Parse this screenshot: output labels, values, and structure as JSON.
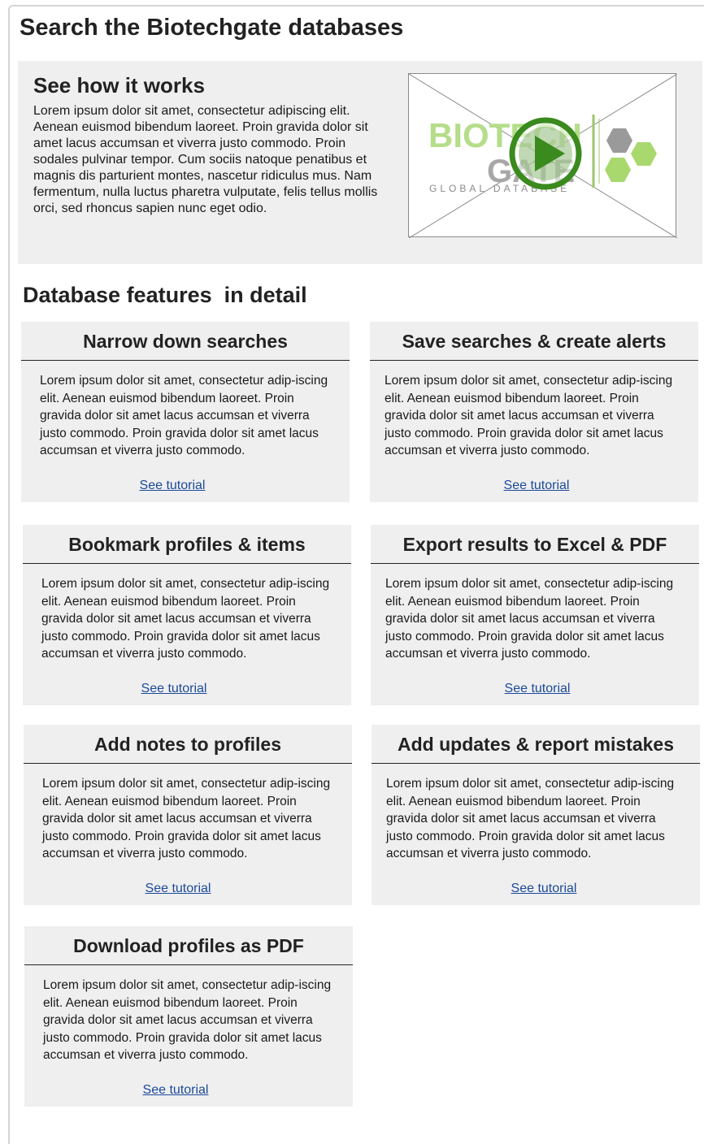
{
  "page": {
    "title": "Search the Biotechgate databases"
  },
  "hero": {
    "title": "See how it works",
    "text": "Lorem ipsum dolor sit amet, consectetur adipiscing elit. Aenean euismod bibendum laoreet. Proin gravida dolor sit amet lacus accumsan et viverra justo commodo. Proin sodales pulvinar tempor. Cum sociis natoque penatibus et magnis dis parturient montes, nascetur ridiculus mus. Nam fermentum, nulla luctus pharetra vulputate, felis tellus mollis orci, sed rhoncus sapien nunc eget odio.",
    "video": {
      "logo_line1": "BIOTECH",
      "logo_line2": "GATE",
      "logo_tagline": "GLOBAL DATABASE",
      "icon": "play-icon"
    }
  },
  "features": {
    "title": "Database features  in detail",
    "cards": [
      {
        "title": "Narrow down searches",
        "text": "Lorem ipsum dolor sit amet, consectetur adip-iscing elit. Aenean euismod bibendum laoreet. Proin gravida dolor sit amet lacus accumsan et viverra justo commodo. Proin gravida dolor sit amet lacus accumsan et viverra justo commodo.",
        "link": "See tutorial"
      },
      {
        "title": "Save searches & create alerts",
        "text": "Lorem ipsum dolor sit amet, consectetur adip-iscing elit. Aenean euismod bibendum laoreet. Proin gravida dolor sit amet lacus accumsan et viverra justo commodo. Proin gravida dolor sit amet lacus accumsan et viverra justo commodo.",
        "link": "See tutorial"
      },
      {
        "title": "Bookmark profiles & items",
        "text": "Lorem ipsum dolor sit amet, consectetur adip-iscing elit. Aenean euismod bibendum laoreet. Proin gravida dolor sit amet lacus accumsan et viverra justo commodo. Proin gravida dolor sit amet lacus accumsan et viverra justo commodo.",
        "link": "See tutorial"
      },
      {
        "title": "Export results to Excel & PDF",
        "text": "Lorem ipsum dolor sit amet, consectetur adip-iscing elit. Aenean euismod bibendum laoreet. Proin gravida dolor sit amet lacus accumsan et viverra justo commodo. Proin gravida dolor sit amet lacus accumsan et viverra justo commodo.",
        "link": "See tutorial"
      },
      {
        "title": "Add notes to profiles",
        "text": "Lorem ipsum dolor sit amet, consectetur adip-iscing elit. Aenean euismod bibendum laoreet. Proin gravida dolor sit amet lacus accumsan et viverra justo commodo. Proin gravida dolor sit amet lacus accumsan et viverra justo commodo.",
        "link": "See tutorial"
      },
      {
        "title": "Add updates & report mistakes",
        "text": "Lorem ipsum dolor sit amet, consectetur adip-iscing elit. Aenean euismod bibendum laoreet. Proin gravida dolor sit amet lacus accumsan et viverra justo commodo. Proin gravida dolor sit amet lacus accumsan et viverra justo commodo.",
        "link": "See tutorial"
      },
      {
        "title": "Download profiles as PDF",
        "text": "Lorem ipsum dolor sit amet, consectetur adip-iscing elit. Aenean euismod bibendum laoreet. Proin gravida dolor sit amet lacus accumsan et viverra justo commodo. Proin gravida dolor sit amet lacus accumsan et viverra justo commodo.",
        "link": "See tutorial"
      }
    ]
  },
  "colors": {
    "panel_background": "#efefef",
    "link": "#1b4a99",
    "brand_green": "#8cc63f",
    "brand_gray": "#8a8a8a",
    "play_green": "#3a8a1e"
  }
}
